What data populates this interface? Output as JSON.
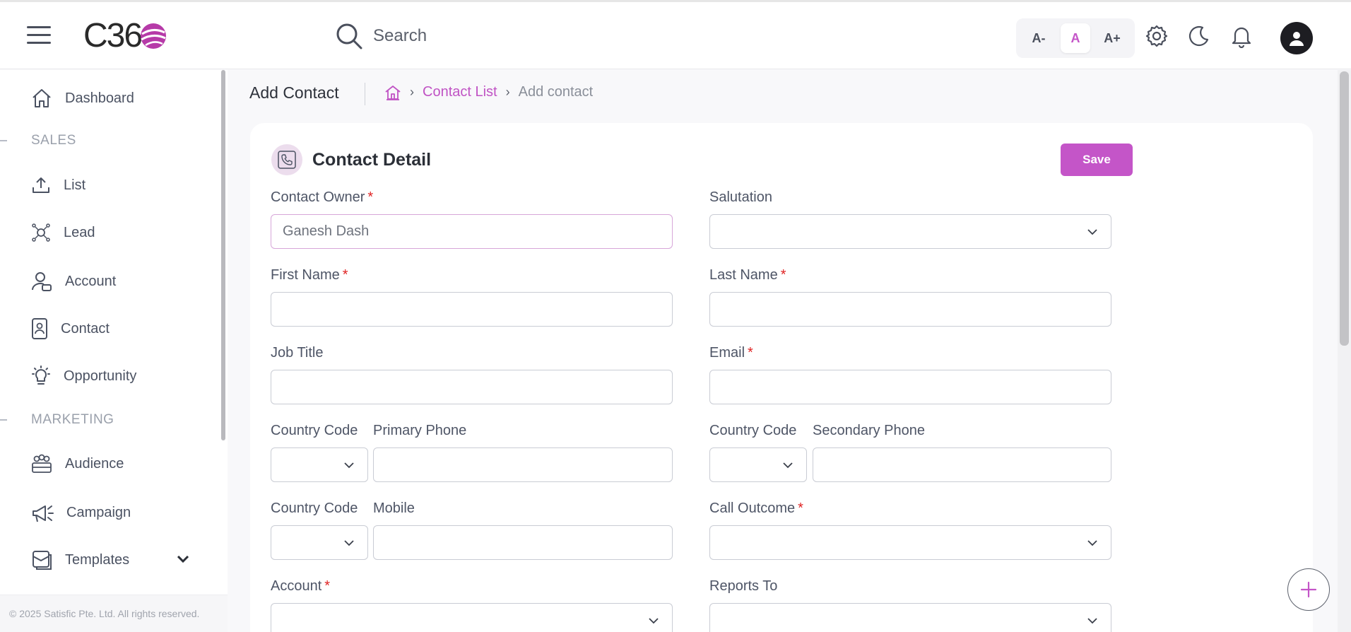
{
  "header": {
    "logo_text": "C36",
    "search_placeholder": "Search",
    "font_sizes": [
      "A-",
      "A",
      "A+"
    ],
    "accent_color": "#c455c8"
  },
  "sidebar": {
    "items": [
      {
        "label": "Dashboard",
        "icon": "home-icon"
      },
      {
        "section": "SALES"
      },
      {
        "label": "List",
        "icon": "upload-icon"
      },
      {
        "label": "Lead",
        "icon": "network-icon"
      },
      {
        "label": "Account",
        "icon": "user-card-icon"
      },
      {
        "label": "Contact",
        "icon": "contact-book-icon"
      },
      {
        "label": "Opportunity",
        "icon": "lightbulb-icon"
      },
      {
        "section": "MARKETING"
      },
      {
        "label": "Audience",
        "icon": "group-icon"
      },
      {
        "label": "Campaign",
        "icon": "megaphone-icon"
      },
      {
        "label": "Templates",
        "icon": "template-icon"
      }
    ],
    "footer": "© 2025 Satisfic Pte. Ltd. All rights reserved."
  },
  "page": {
    "title": "Add Contact",
    "breadcrumb": {
      "link": "Contact List",
      "current": "Add contact"
    }
  },
  "form": {
    "title": "Contact Detail",
    "save_label": "Save",
    "contact_owner": {
      "label": "Contact Owner",
      "value": "Ganesh Dash"
    },
    "salutation": {
      "label": "Salutation"
    },
    "first_name": {
      "label": "First Name"
    },
    "last_name": {
      "label": "Last Name"
    },
    "job_title": {
      "label": "Job Title"
    },
    "email": {
      "label": "Email"
    },
    "country_code_label": "Country Code",
    "primary_phone": {
      "label": "Primary Phone"
    },
    "secondary_phone": {
      "label": "Secondary Phone"
    },
    "mobile": {
      "label": "Mobile"
    },
    "call_outcome": {
      "label": "Call Outcome"
    },
    "account": {
      "label": "Account"
    },
    "reports_to": {
      "label": "Reports To"
    },
    "required_mark": "*"
  }
}
